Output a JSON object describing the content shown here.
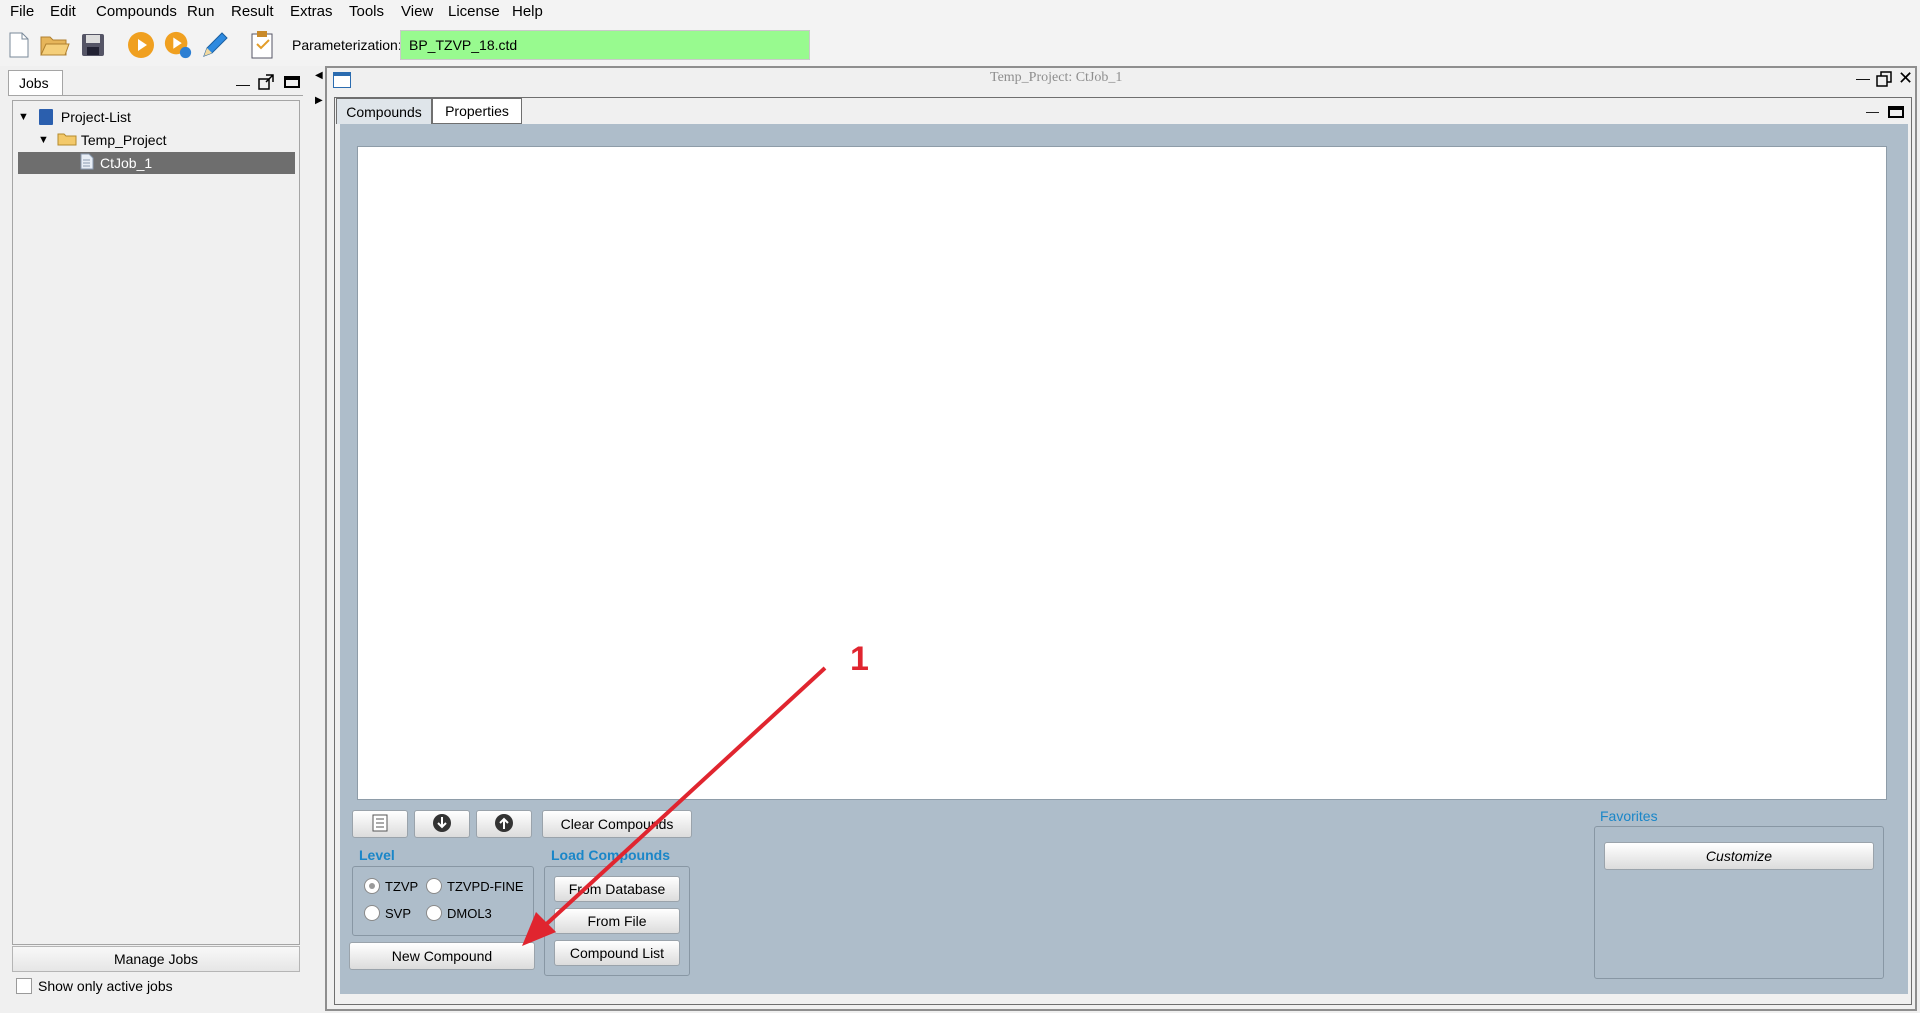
{
  "menu": [
    "File",
    "Edit",
    "Compounds",
    "Run",
    "Result",
    "Extras",
    "Tools",
    "View",
    "License",
    "Help"
  ],
  "toolbar": {
    "icons": [
      "new-file-icon",
      "open-folder-icon",
      "save-icon",
      "run-icon",
      "run-settings-icon",
      "edit-pencil-icon",
      "clipboard-icon"
    ],
    "parameterization_label": "Parameterization:",
    "parameterization_value": "BP_TZVP_18.ctd",
    "parameterization_color": "#98fa8f"
  },
  "jobs_panel": {
    "tab": "Jobs",
    "tree": {
      "root": "Project-List",
      "project": "Temp_Project",
      "job": "CtJob_1"
    },
    "manage_button": "Manage Jobs",
    "only_active_label": "Show only active jobs",
    "only_active_checked": false
  },
  "job_window": {
    "title": "Temp_Project: CtJob_1",
    "tabs": [
      "Compounds",
      "Properties"
    ],
    "active_tab": "Compounds",
    "toolbar_buttons": {
      "clear": "Clear Compounds"
    },
    "level": {
      "title": "Level",
      "options": [
        "TZVP",
        "TZVPD-FINE",
        "SVP",
        "DMOL3"
      ],
      "selected": "TZVP"
    },
    "load": {
      "title": "Load Compounds",
      "from_database": "From Database",
      "from_file": "From File",
      "compound_list": "Compound List"
    },
    "new_compound": "New Compound",
    "favorites": {
      "title": "Favorites",
      "customize": "Customize"
    }
  },
  "annotation": {
    "label": "1",
    "color": "#e0252f"
  }
}
